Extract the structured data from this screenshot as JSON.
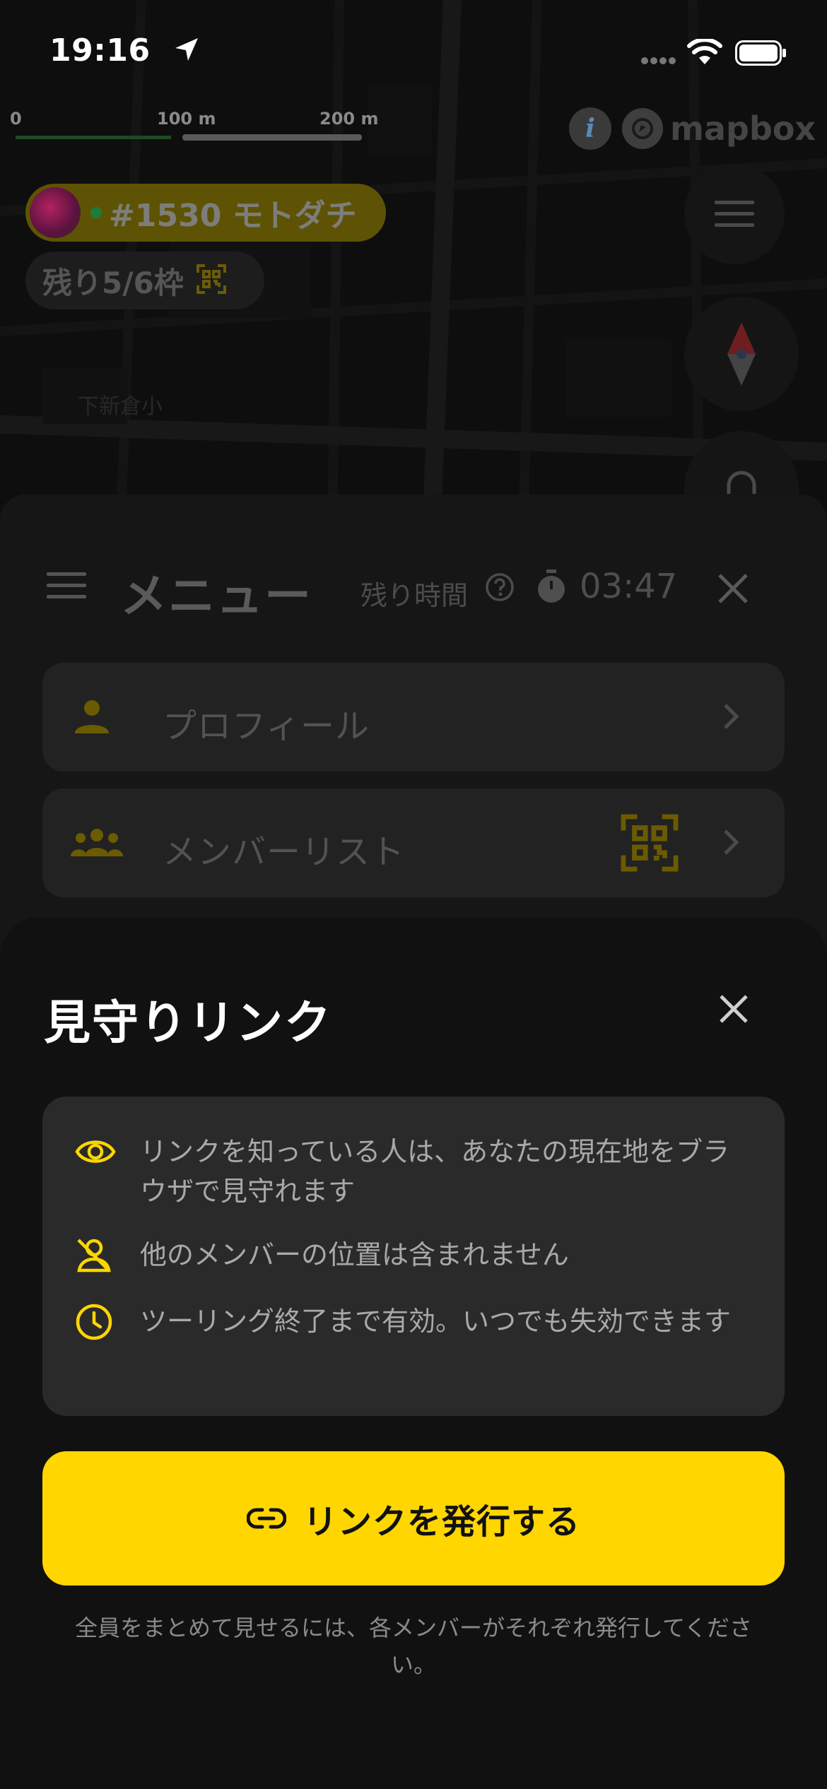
{
  "status_bar": {
    "time": "19:16",
    "icons": [
      "location-arrow-icon",
      "cellular-signal-icon",
      "wifi-icon",
      "battery-icon"
    ]
  },
  "map": {
    "scale_labels": [
      "0",
      "100 m",
      "200 m"
    ],
    "attribution_info": "i",
    "attribution_logo": "mapbox",
    "group_label": "#1530 モトダチ",
    "slots_label": "残り5/6枠",
    "place_label": "下新倉小"
  },
  "menu": {
    "title": "メニュー",
    "remaining_label": "残り時間",
    "timer": "03:47",
    "items": [
      {
        "label": "プロフィール",
        "icon": "person-icon"
      },
      {
        "label": "メンバーリスト",
        "icon": "group-icon"
      }
    ]
  },
  "sheet": {
    "title": "見守りリンク",
    "info": [
      {
        "icon": "eye-icon",
        "text": "リンクを知っている人は、あなたの現在地をブラウザで見守れます"
      },
      {
        "icon": "person-off-icon",
        "text": "他のメンバーの位置は含まれません"
      },
      {
        "icon": "clock-icon",
        "text": "ツーリング終了まで有効。いつでも失効できます"
      }
    ],
    "button_label": "リンクを発行する",
    "note": "全員をまとめて見せるには、各メンバーがそれぞれ発行してください。"
  },
  "colors": {
    "accent": "#ffd600",
    "sheet_bg": "#111111",
    "card_bg": "#2a2a2a"
  }
}
